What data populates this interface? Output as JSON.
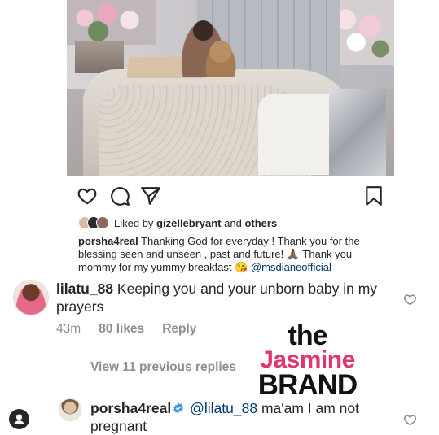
{
  "post": {
    "like_icon": "heart-outline-icon",
    "comment_icon": "comment-bubble-icon",
    "share_icon": "paper-plane-icon",
    "save_icon": "bookmark-icon"
  },
  "likes": {
    "prefix": "Liked by",
    "user": "gizellebryant",
    "conj": "and",
    "others": "others"
  },
  "caption": {
    "username": "porsha4real",
    "text": "Thanking God for everyday ! Thank you for the blessing seen and unseen , past and future! 🙏🏾 Thank you mommy for my yummy breakfast 😘",
    "mention": "@msdianeofficial"
  },
  "comment1": {
    "username": "lilatu_88",
    "text": "Keeping you and your unborn baby in my prayers",
    "time": "43m",
    "likes": "80 likes",
    "reply": "Reply"
  },
  "view_replies": "View 11 previous replies",
  "logo": {
    "line1": "the",
    "line2": "Jasmine",
    "line3": "BRAND"
  },
  "reply": {
    "username": "porsha4real",
    "mention": "@lilatu_88",
    "text": "ma'am I am not pregnant"
  },
  "colors": {
    "text": "#262626",
    "muted": "#8e8e8e",
    "link": "#00376b",
    "verified": "#3897f0",
    "logo_pink": "#e0366f"
  }
}
